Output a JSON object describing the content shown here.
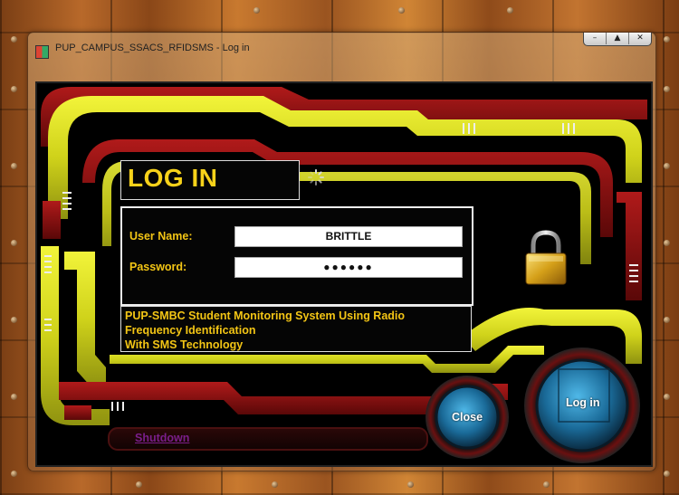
{
  "window": {
    "title": "PUP_CAMPUS_SSACS_RFIDSMS - Log in",
    "caption_buttons": [
      "–",
      "▲",
      "✕"
    ]
  },
  "form": {
    "heading": "LOG IN",
    "username_label": "User Name:",
    "username_value": "BRITTLE",
    "password_label": "Password:",
    "password_value": "●●●●●●"
  },
  "description": {
    "lines": [
      "PUP-SMBC Student Monitoring System Using Radio",
      "Frequency Identification",
      "With SMS Technology"
    ]
  },
  "buttons": {
    "close_label": "Close",
    "login_label": "Log in",
    "shutdown_label": "Shutdown"
  },
  "icons": {
    "lock": "padlock-icon",
    "spinner": "loading-spinner-icon",
    "app": "app-icon"
  },
  "colors": {
    "accent_yellow": "#f3c515",
    "frame_yellow": "#d8dc1c",
    "frame_red": "#8a1212",
    "button_blue": "#1e78a8",
    "link_purple": "#7a1e8a"
  }
}
